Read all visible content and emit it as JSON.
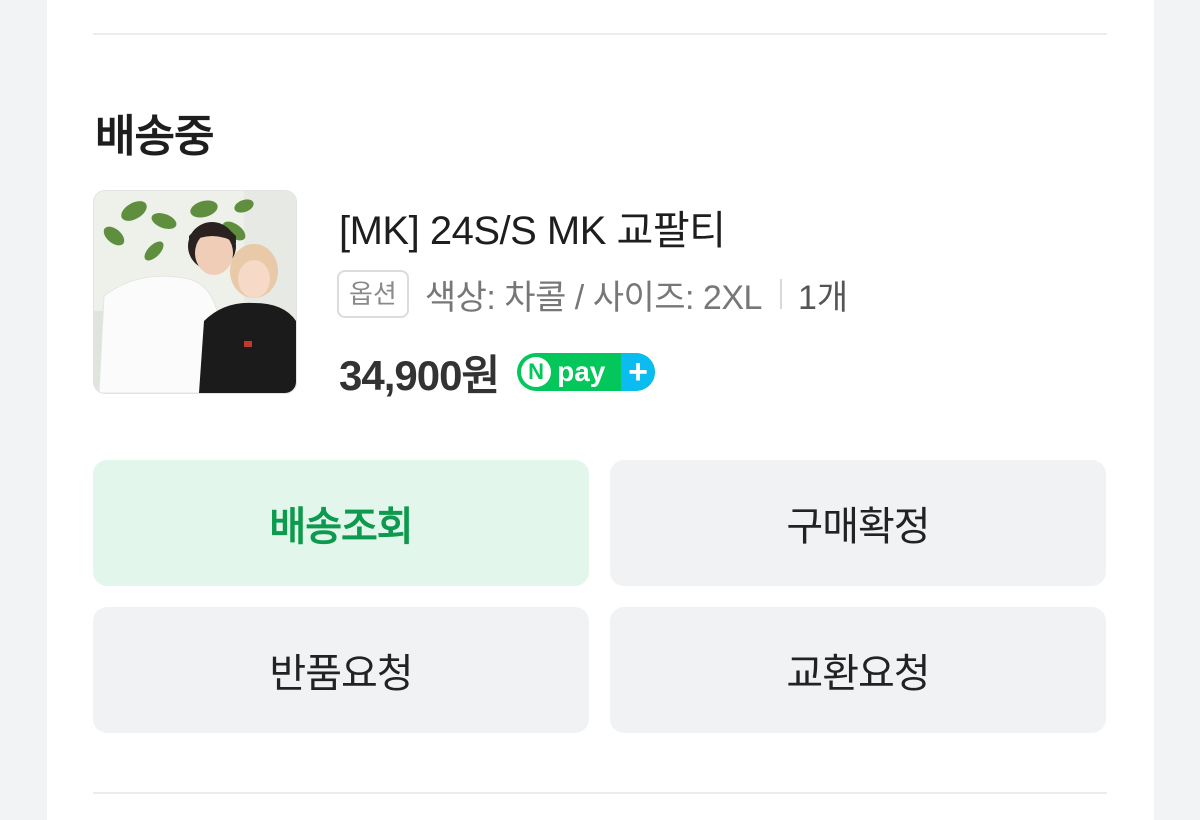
{
  "order": {
    "status": "배송중",
    "product": {
      "name": "[MK] 24S/S MK 교팔티",
      "option_badge": "옵션",
      "option_text": "색상: 차콜 / 사이즈: 2XL",
      "quantity": "1개",
      "price": "34,900원",
      "payment_badge": {
        "n": "N",
        "text": "pay",
        "plus": "+"
      },
      "thumbnail_icon": "product-photo"
    },
    "actions": {
      "track": "배송조회",
      "confirm": "구매확정",
      "return": "반품요청",
      "exchange": "교환요청"
    }
  },
  "colors": {
    "accent_green": "#0e9a4e",
    "primary_button_bg": "#e3f6ec",
    "secondary_button_bg": "#f1f2f4",
    "npay_green": "#03c75a"
  }
}
